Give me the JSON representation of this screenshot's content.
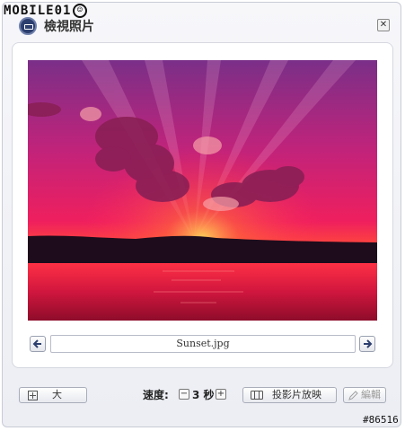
{
  "watermark": {
    "text": "MOBILE01"
  },
  "dialog": {
    "title": "檢視照片",
    "close_symbol": "✕"
  },
  "photo": {
    "description_icon": "sunset-photo",
    "filename": "Sunset.jpg"
  },
  "toolbar": {
    "zoom_label": "大",
    "speed_label": "速度:",
    "minus_symbol": "−",
    "speed_value": "3 秒",
    "plus_symbol": "+",
    "slideshow_label": "投影片放映",
    "edit_label": "編輯"
  },
  "footer": {
    "id_tag": "#86516"
  },
  "colors": {
    "sky_top": "#8a2f86",
    "sky_mid": "#e0186a",
    "horizon": "#ff3b3b",
    "water": "#c8103a",
    "hills": "#1e0c1c"
  }
}
